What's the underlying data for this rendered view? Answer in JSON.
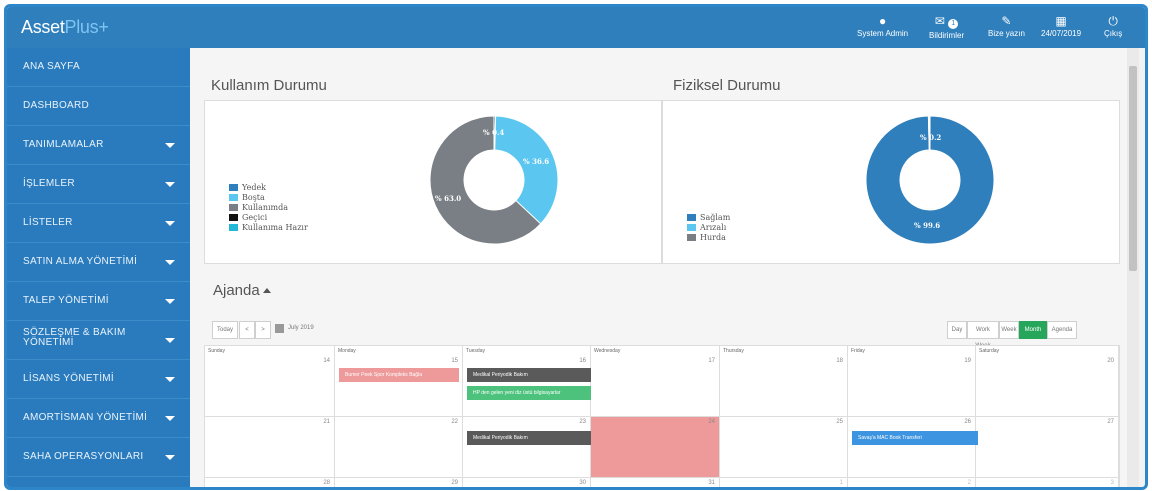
{
  "app": {
    "logo_main": "Asset",
    "logo_plus": "Plus+"
  },
  "topbar": {
    "items": [
      {
        "icon": "user-icon",
        "label": "System Admin"
      },
      {
        "icon": "megaphone-icon",
        "label": "Bildirimler",
        "badge": "1"
      },
      {
        "icon": "pencil-icon",
        "label": "Bize yazın"
      },
      {
        "icon": "calendar-icon",
        "label": "24/07/2019"
      },
      {
        "icon": "power-icon",
        "label": "Çıkış"
      }
    ]
  },
  "sidebar": {
    "items": [
      {
        "label": "ANA SAYFA",
        "has_arrow": false
      },
      {
        "label": "DASHBOARD",
        "has_arrow": false
      },
      {
        "label": "TANIMLAMALAR",
        "has_arrow": true
      },
      {
        "label": "İŞLEMLER",
        "has_arrow": true
      },
      {
        "label": "LİSTELER",
        "has_arrow": true
      },
      {
        "label": "SATIN ALMA YÖNETİMİ",
        "has_arrow": true
      },
      {
        "label": "TALEP YÖNETİMİ",
        "has_arrow": true
      },
      {
        "label": "SÖZLEŞME & BAKIM",
        "label_line2": "YÖNETİMİ",
        "has_arrow": true
      },
      {
        "label": "LİSANS YÖNETİMİ",
        "has_arrow": true
      },
      {
        "label": "AMORTİSMAN YÖNETİMİ",
        "has_arrow": true
      },
      {
        "label": "SAHA OPERASYONLARI",
        "has_arrow": true
      }
    ]
  },
  "usage": {
    "title": "Kullanım Durumu",
    "legend": [
      "Yedek",
      "Boşta",
      "Kullanımda",
      "Geçici",
      "Kullanıma Hazır"
    ],
    "labels": [
      "% 0.4",
      "% 36.6",
      "% 63.0"
    ]
  },
  "physical": {
    "title": "Fiziksel Durumu",
    "legend": [
      "Sağlam",
      "Arızalı",
      "Hurda"
    ],
    "labels": [
      "% 0.2",
      "% 99.6"
    ]
  },
  "chart_data": [
    {
      "type": "pie",
      "title": "Kullanım Durumu",
      "categories": [
        "Yedek",
        "Boşta",
        "Kullanımda",
        "Geçici",
        "Kullanıma Hazır"
      ],
      "values": [
        0.4,
        36.6,
        63.0,
        0,
        0
      ],
      "colors": [
        "#2f7fbc",
        "#5bc7f0",
        "#7a7f85",
        "#111111",
        "#22b8d8"
      ],
      "donut": true,
      "legend": "left"
    },
    {
      "type": "pie",
      "title": "Fiziksel Durumu",
      "categories": [
        "Sağlam",
        "Arızalı",
        "Hurda"
      ],
      "values": [
        99.6,
        0.2,
        0.2
      ],
      "colors": [
        "#2f7fbc",
        "#5bc7f0",
        "#7a7f85"
      ],
      "donut": true,
      "legend": "left"
    }
  ],
  "agenda": {
    "title": "Ajanda",
    "toolbar": {
      "today": "Today",
      "prev": "<",
      "next": ">",
      "month_label": "July 2019"
    },
    "views": [
      "Day",
      "Work Week",
      "Week",
      "Month",
      "Agenda"
    ],
    "active_view": "Month",
    "weekdays": [
      "Sunday",
      "Monday",
      "Tuesday",
      "Wednesday",
      "Thursday",
      "Friday",
      "Saturday"
    ],
    "weeks": [
      [
        "14",
        "15",
        "16",
        "17",
        "18",
        "19",
        "20"
      ],
      [
        "21",
        "22",
        "23",
        "24",
        "25",
        "26",
        "27"
      ],
      [
        "28",
        "29",
        "30",
        "31",
        "1",
        "2",
        "3"
      ]
    ],
    "events": [
      {
        "title": "Bumer Peek Spor Kompleks Bağla",
        "color": "#ee9a9a"
      },
      {
        "title": "Medikal Periyodik Bakım",
        "color": "#5a5a5a"
      },
      {
        "title": "HP den gelen yeni diz üstü bilgisayarlar",
        "color": "#4cc27c"
      },
      {
        "title": "Medikal Periyodik Bakım",
        "color": "#5a5a5a"
      },
      {
        "title": "Savaş'a MAC Book Transferi",
        "color": "#3d94e0"
      }
    ]
  }
}
